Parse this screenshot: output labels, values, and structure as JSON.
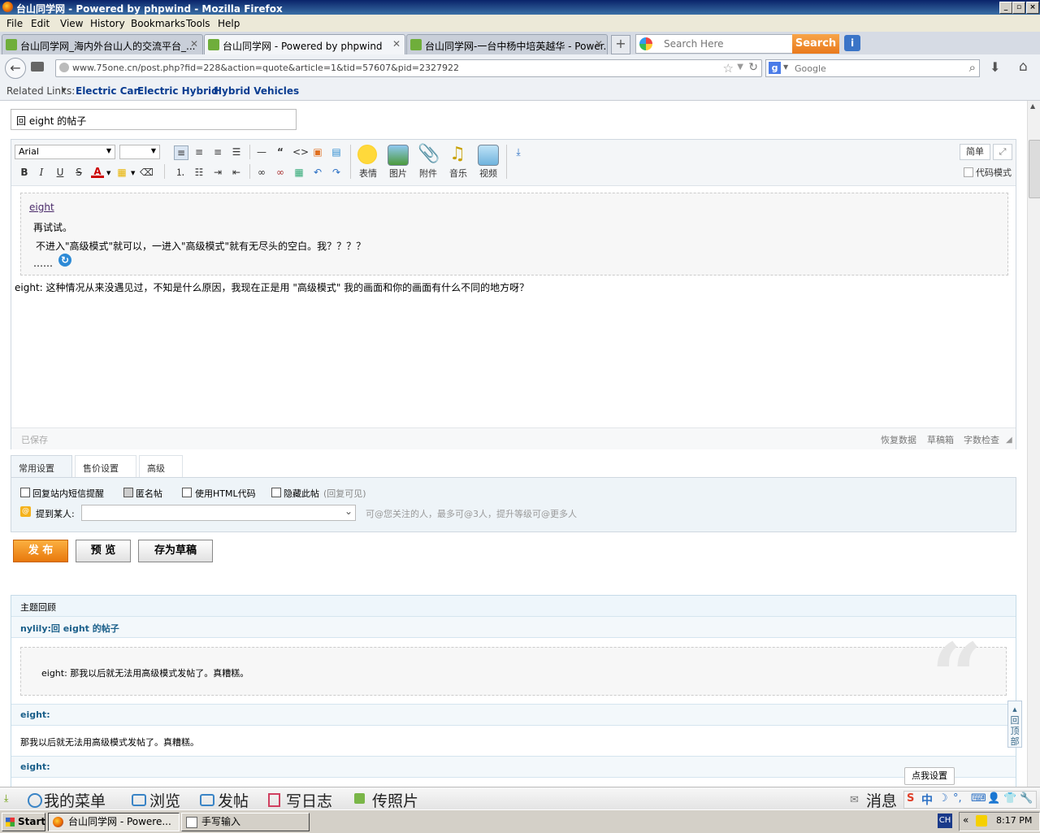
{
  "window": {
    "title": "台山同学网 - Powered by phpwind - Mozilla Firefox"
  },
  "menu": [
    "File",
    "Edit",
    "View",
    "History",
    "Bookmarks",
    "Tools",
    "Help"
  ],
  "tabs": [
    {
      "label": "台山同学网_海内外台山人的交流平台_..."
    },
    {
      "label": "台山同学网 - Powered by phpwind"
    },
    {
      "label": "台山同学网-一台中杨中培英越华 - Power..."
    }
  ],
  "search": {
    "placeholder": "Search Here",
    "button": "Search"
  },
  "address": {
    "url": "www.75one.cn/post.php?fid=228&action=quote&article=1&tid=57607&pid=2327922"
  },
  "google": {
    "placeholder": "Google"
  },
  "related": {
    "label": "Related Links:",
    "links": [
      "Electric Car",
      "Electric Hybrid",
      "Hybrid Vehicles"
    ]
  },
  "post": {
    "subject": "回 eight 的帖子"
  },
  "editor": {
    "font": "Arial",
    "simple_btn": "简单",
    "code_mode": "代码模式",
    "tools": [
      "表情",
      "图片",
      "附件",
      "音乐",
      "视频"
    ],
    "quote_author": "eight",
    "quote_lines": [
      "再试试。",
      "不进入\"高级模式\"就可以，一进入\"高级模式\"就有无尽头的空白。我？？？？",
      "……"
    ],
    "reply_text": "eight: 这种情况从来没遇见过，不知是什么原因，我现在正是用 \"高级模式\" 我的画面和你的画面有什么不同的地方呀？",
    "saved": "已保存",
    "footer_links": [
      "恢复数据",
      "草稿箱",
      "字数检查"
    ]
  },
  "settings": {
    "tabs": [
      "常用设置",
      "售价设置",
      "高级"
    ],
    "options": [
      "回复站内短信提醒",
      "匿名帖",
      "使用HTML代码",
      "隐藏此帖"
    ],
    "hidden_hint": "(回复可见)",
    "mention_label": "提到某人:",
    "mention_hint": "可@您关注的人，最多可@3人，提升等级可@更多人"
  },
  "buttons": {
    "publish": "发 布",
    "preview": "预 览",
    "draft": "存为草稿"
  },
  "review": {
    "title": "主题回顾",
    "post1_author": "nylily:回 eight 的帖子",
    "post1_quote": "eight: 那我以后就无法用高级模式发帖了。真糟糕。",
    "post2_author": "eight:",
    "post2_text": "那我以后就无法用高级模式发帖了。真糟糕。",
    "post3_author": "eight:",
    "back_top": "回顶部",
    "settings_tip": "点我设置"
  },
  "bottombar": [
    "我的菜单",
    "浏览",
    "发帖",
    "写日志",
    "传照片",
    "消息"
  ],
  "taskbar": {
    "start": "Start",
    "tasks": [
      "台山同学网 - Powere...",
      "手写输入"
    ],
    "lang": "CH",
    "time": "8:17 PM"
  }
}
